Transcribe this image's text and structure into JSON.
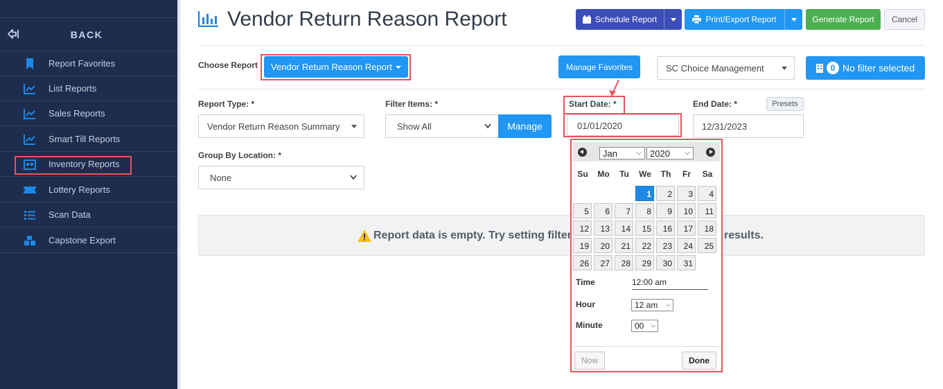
{
  "sidebar": {
    "back_label": "BACK",
    "items": [
      {
        "label": "Report Favorites",
        "icon": "bookmark-icon"
      },
      {
        "label": "List Reports",
        "icon": "line-chart-icon"
      },
      {
        "label": "Sales Reports",
        "icon": "line-chart-icon"
      },
      {
        "label": "Smart Till Reports",
        "icon": "line-chart-icon"
      },
      {
        "label": "Inventory Reports",
        "icon": "inventory-icon"
      },
      {
        "label": "Lottery Reports",
        "icon": "ticket-icon"
      },
      {
        "label": "Scan Data",
        "icon": "list-icon"
      },
      {
        "label": "Capstone Export",
        "icon": "boxes-icon"
      }
    ]
  },
  "header": {
    "title": "Vendor Return Reason Report",
    "schedule_label": "Schedule Report",
    "print_label": "Print/Export Report",
    "generate_label": "Generate Report",
    "cancel_label": "Cancel"
  },
  "choose": {
    "label": "Choose Report",
    "report_button": "Vendor Return Reason Report",
    "manage_favorites": "Manage Favorites",
    "company": "SC Choice Management",
    "filter_count": "0",
    "filter_label": "No filter selected"
  },
  "form": {
    "report_type_label": "Report Type: *",
    "report_type_value": "Vendor Return Reason Summary",
    "filter_items_label": "Filter Items: *",
    "filter_items_value": "Show All",
    "manage_label": "Manage",
    "start_date_label": "Start Date: *",
    "start_date_value": "01/01/2020",
    "end_date_label": "End Date: *",
    "end_date_value": "12/31/2023",
    "presets_label": "Presets",
    "group_by_label": "Group By Location: *",
    "group_by_value": "None"
  },
  "empty_message": {
    "left": "Report data is empty. Try setting filter",
    "right": "results."
  },
  "datepicker": {
    "month": "Jan",
    "year": "2020",
    "dow": [
      "Su",
      "Mo",
      "Tu",
      "We",
      "Th",
      "Fr",
      "Sa"
    ],
    "first_weekday": 3,
    "days_in_month": 31,
    "selected_day": 1,
    "time_label": "Time",
    "time_value": "12:00 am",
    "hour_label": "Hour",
    "hour_value": "12 am",
    "minute_label": "Minute",
    "minute_value": "00",
    "now_label": "Now",
    "done_label": "Done"
  },
  "colors": {
    "sidebar_bg": "#1e2d4d",
    "primary": "#2196f3",
    "schedule": "#3d4db7",
    "generate": "#4caf50",
    "highlight": "#e5555a"
  }
}
